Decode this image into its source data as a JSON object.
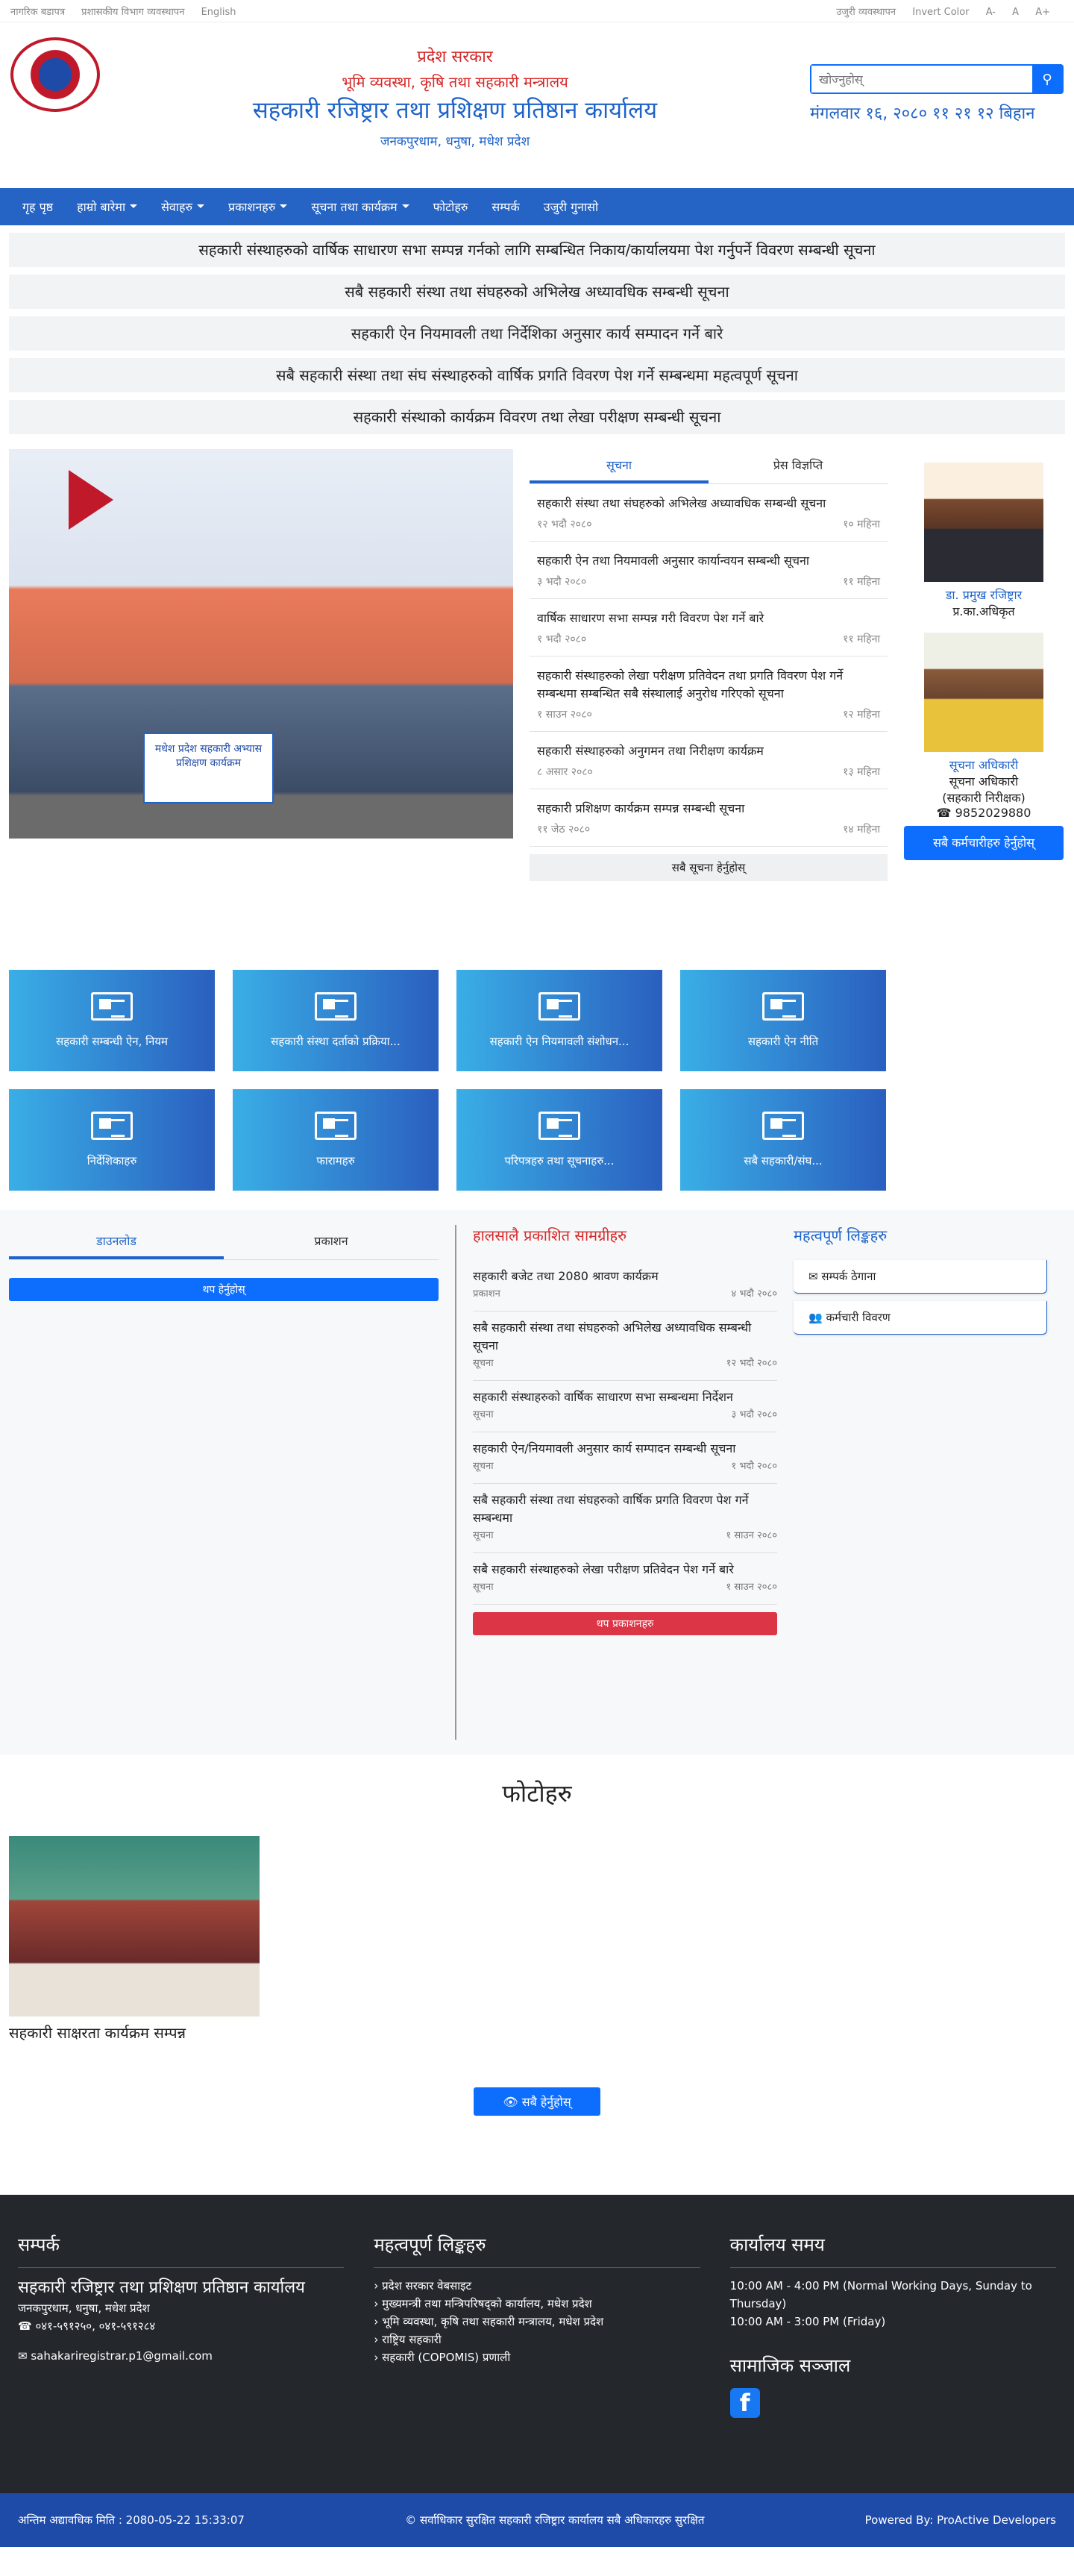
{
  "topbar": {
    "left": [
      "नागरिक बडापत्र",
      "प्रशासकीय विभाग व्यवस्थापन",
      "English"
    ],
    "right": [
      "उजुरी व्यवस्थापन",
      "Invert Color",
      "A-",
      "A",
      "A+"
    ]
  },
  "header": {
    "line1": "प्रदेश सरकार",
    "line2": "भूमि व्यवस्था, कृषि तथा सहकारी मन्त्रालय",
    "line3": "सहकारी रजिष्ट्रार तथा प्रशिक्षण प्रतिष्ठान कार्यालय",
    "line4": "जनकपुरधाम, धनुषा, मधेश प्रदेश",
    "search_placeholder": "खोज्नुहोस्",
    "date": "मंगलवार १६, २०८० ११ २१ १२ बिहान"
  },
  "nav": [
    "गृह पृष्ठ",
    "हाम्रो बारेमा",
    "सेवाहरु",
    "प्रकाशनहरु",
    "सूचना तथा कार्यक्रम",
    "फोटोहरु",
    "सम्पर्क",
    "उजुरी गुनासो"
  ],
  "notices": [
    "सहकारी संस्थाहरुको वार्षिक साधारण सभा सम्पन्न गर्नको लागि सम्बन्धित निकाय/कार्यालयमा पेश गर्नुपर्ने विवरण सम्बन्धी सूचना",
    "सबै सहकारी संस्था तथा संघहरुको अभिलेख अध्यावधिक सम्बन्धी सूचना",
    "सहकारी ऐन नियमावली तथा निर्देशिका अनुसार कार्य सम्पादन गर्ने बारे",
    "सबै सहकारी संस्था तथा संघ संस्थाहरुको वार्षिक प्रगति विवरण पेश गर्ने सम्बन्धमा महत्वपूर्ण सूचना",
    "सहकारी संस्थाको कार्यक्रम विवरण तथा लेखा परीक्षण सम्बन्धी सूचना"
  ],
  "photo": {
    "banner": "मधेश प्रदेश सहकारी अभ्यास प्रशिक्षण कार्यक्रम"
  },
  "news": {
    "tabs": [
      "सूचना",
      "प्रेस विज्ञप्ति"
    ],
    "items": [
      {
        "title": "सहकारी संस्था तथा संघहरुको अभिलेख अध्यावधिक सम्बन्धी सूचना",
        "date": "१२ भदौ २०८०",
        "meta": "१० महिना"
      },
      {
        "title": "सहकारी ऐन तथा नियमावली अनुसार कार्यान्वयन सम्बन्धी सूचना",
        "date": "३ भदौ २०८०",
        "meta": "११ महिना"
      },
      {
        "title": "वार्षिक साधारण सभा सम्पन्न गरी विवरण पेश गर्ने बारे",
        "date": "१ भदौ २०८०",
        "meta": "११ महिना"
      },
      {
        "title": "सहकारी संस्थाहरुको लेखा परीक्षण प्रतिवेदन तथा प्रगति विवरण पेश गर्ने सम्बन्धमा सम्बन्धित सबै संस्थालाई अनुरोध गरिएको सूचना",
        "date": "१ साउन २०८०",
        "meta": "१२ महिना"
      },
      {
        "title": "सहकारी संस्थाहरुको अनुगमन तथा निरीक्षण कार्यक्रम",
        "date": "८ असार २०८०",
        "meta": "१३ महिना"
      },
      {
        "title": "सहकारी प्रशिक्षण कार्यक्रम सम्पन्न सम्बन्धी सूचना",
        "date": "११ जेठ २०८०",
        "meta": "१४ महिना"
      }
    ],
    "view_all": "सबै सूचना हेर्नुहोस्"
  },
  "people": [
    {
      "name": "डा. प्रमुख रजिष्ट्रार",
      "role": "प्र.का.अधिकृत"
    },
    {
      "name": "सूचना अधिकारी",
      "role": "सूचना अधिकारी",
      "note": "(सहकारी निरीक्षक)",
      "phone": "9852029880"
    }
  ],
  "people_button": "सबै कर्मचारीहरु हेर्नुहोस्",
  "tiles": [
    "सहकारी सम्बन्धी ऐन, नियम",
    "सहकारी संस्था दर्ताको प्रक्रिया...",
    "सहकारी ऐन नियमावली संशोधन...",
    "सहकारी ऐन नीति",
    "निर्देशिकाहरु",
    "फारामहरु",
    "परिपत्रहरु तथा सूचनाहरु...",
    "सबै सहकारी/संघ..."
  ],
  "lower": {
    "tabs": [
      "डाउनलोड",
      "प्रकाशन"
    ],
    "more": "थप हेर्नुहोस्",
    "recent_title": "हालसालै प्रकाशित सामग्रीहरु",
    "recent": [
      {
        "title": "सहकारी बजेट तथा 2080 श्रावण कार्यक्रम",
        "type": "प्रकाशन",
        "date": "४ भदौ २०८०"
      },
      {
        "title": "सबै सहकारी संस्था तथा संघहरुको अभिलेख अध्यावधिक सम्बन्धी सूचना",
        "type": "सूचना",
        "date": "१२ भदौ २०८०"
      },
      {
        "title": "सहकारी संस्थाहरुको वार्षिक साधारण सभा सम्बन्धमा निर्देशन",
        "type": "सूचना",
        "date": "३ भदौ २०८०"
      },
      {
        "title": "सहकारी ऐन/नियमावली अनुसार कार्य सम्पादन सम्बन्धी सूचना",
        "type": "सूचना",
        "date": "१ भदौ २०८०"
      },
      {
        "title": "सबै सहकारी संस्था तथा संघहरुको वार्षिक प्रगति विवरण पेश गर्ने सम्बन्धमा",
        "type": "सूचना",
        "date": "१ साउन २०८०"
      },
      {
        "title": "सबै सहकारी संस्थाहरुको लेखा परीक्षण प्रतिवेदन पेश गर्ने बारे",
        "type": "सूचना",
        "date": "१ साउन २०८०"
      }
    ],
    "recent_more": "थप प्रकाशनहरु",
    "links_title": "महत्वपूर्ण लिङ्कहरु",
    "links": [
      "सम्पर्क ठेगाना",
      "कर्मचारी विवरण"
    ]
  },
  "gallery": {
    "title": "फोटोहरु",
    "caption": "सहकारी साक्षरता कार्यक्रम सम्पन्न",
    "button": "सबै हेर्नुहोस्"
  },
  "footer": {
    "contact_title": "सम्पर्क",
    "office": "सहकारी रजिष्ट्रार तथा प्रशिक्षण प्रतिष्ठान कार्यालय",
    "address": "जनकपुरधाम, धनुषा, मधेश प्रदेश",
    "phone": "०४१-५९१२५०, ०४१-५९१२८४",
    "email": "sahakariregistrar.p1@gmail.com",
    "links_title": "महत्वपूर्ण लिङ्कहरु",
    "links": [
      "प्रदेश सरकार वेबसाइट",
      "मुख्यमन्त्री तथा मन्त्रिपरिषद्को कार्यालय, मधेश प्रदेश",
      "भूमि व्यवस्था, कृषि तथा सहकारी मन्त्रालय, मधेश प्रदेश",
      "राष्ट्रिय सहकारी",
      "सहकारी (COPOMIS) प्रणाली"
    ],
    "hours_title": "कार्यालय समय",
    "hours1": "10:00 AM - 4:00 PM (Normal Working Days, Sunday to Thursday)",
    "hours2": "10:00 AM - 3:00 PM (Friday)",
    "social_title": "सामाजिक सञ्जाल"
  },
  "bottombar": {
    "updated": "अन्तिम अद्यावधिक मिति : 2080-05-22 15:33:07",
    "copyright": "© सर्वाधिकार सुरक्षित सहकारी रजिष्ट्रार कार्यालय सबै अधिकारहरु सुरक्षित",
    "powered": "Powered By: ProActive Developers"
  }
}
